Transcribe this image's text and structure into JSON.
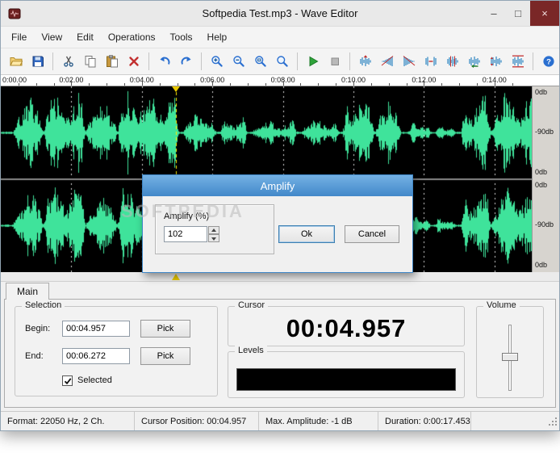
{
  "window": {
    "title": "Softpedia Test.mp3 - Wave Editor",
    "controls": {
      "minimize": "–",
      "maximize": "□",
      "close": "×"
    }
  },
  "menu": {
    "items": [
      "File",
      "View",
      "Edit",
      "Operations",
      "Tools",
      "Help"
    ]
  },
  "toolbar": {
    "groups": [
      [
        "open",
        "save"
      ],
      [
        "cut",
        "copy",
        "paste",
        "delete"
      ],
      [
        "undo",
        "redo"
      ],
      [
        "zoom-in",
        "zoom-out",
        "zoom-selection",
        "zoom-all"
      ],
      [
        "play",
        "stop"
      ],
      [
        "wave-amplify",
        "wave-fade-in",
        "wave-fade-out",
        "wave-insert-silence",
        "wave-delete-silence",
        "wave-reverse",
        "wave-invert",
        "wave-normalize"
      ],
      [
        "help"
      ]
    ]
  },
  "timeline": {
    "ticks": [
      {
        "t": 0,
        "label": "0:00.00"
      },
      {
        "t": 2,
        "label": "0:02.00"
      },
      {
        "t": 4,
        "label": "0:04.00"
      },
      {
        "t": 6,
        "label": "0:06.00"
      },
      {
        "t": 8,
        "label": "0:08.00"
      },
      {
        "t": 10,
        "label": "0:10.00"
      },
      {
        "t": 12,
        "label": "0:12.00"
      },
      {
        "t": 14,
        "label": "0:14.00"
      }
    ]
  },
  "waveform": {
    "db_labels": [
      "0db",
      "-90db",
      "0db"
    ],
    "color": "#3fe39b",
    "background": "#000000",
    "cursor_seconds": 4.957,
    "watermark": "SOFTPEDIA"
  },
  "dialog": {
    "title": "Amplify",
    "field_label": "Amplify (%)",
    "value": "102",
    "ok_label": "Ok",
    "cancel_label": "Cancel"
  },
  "panel": {
    "tab": "Main",
    "selection": {
      "title": "Selection",
      "begin_label": "Begin:",
      "begin_value": "00:04.957",
      "end_label": "End:",
      "end_value": "00:06.272",
      "pick_label": "Pick",
      "selected_label": "Selected",
      "selected_checked": true
    },
    "cursor": {
      "title": "Cursor",
      "value": "00:04.957"
    },
    "levels": {
      "title": "Levels"
    },
    "volume": {
      "title": "Volume"
    }
  },
  "statusbar": {
    "format": "Format: 22050 Hz, 2 Ch.",
    "cursor": "Cursor Position: 00:04.957",
    "amplitude": "Max. Amplitude: -1 dB",
    "duration": "Duration: 0:00:17.453"
  }
}
